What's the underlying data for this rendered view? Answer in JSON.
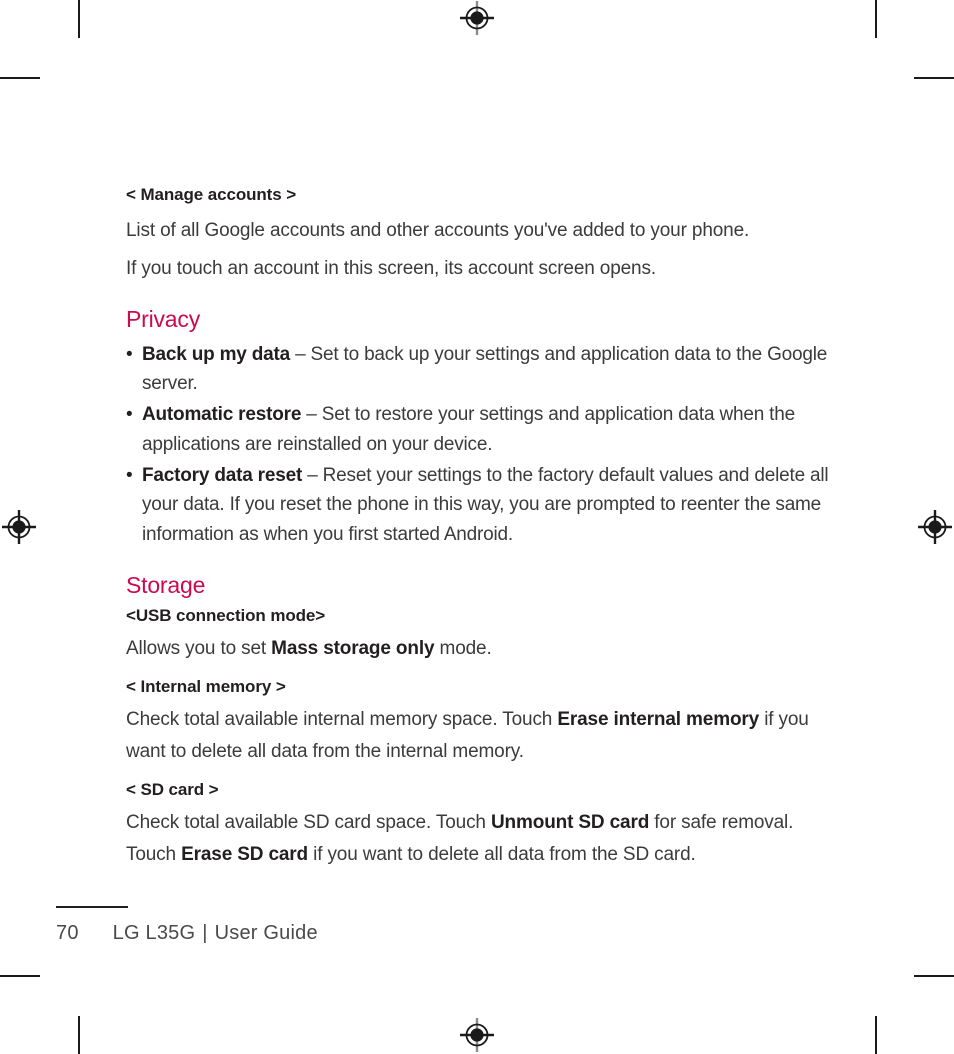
{
  "page": {
    "number": "70",
    "footer_title": "LG L35G",
    "footer_separator": "|",
    "footer_subtitle": "User Guide"
  },
  "theme": {
    "heading_color": "#CC0A4E",
    "body_color": "#3b3b3b",
    "bold_color": "#231f20"
  },
  "sections": {
    "manage_accounts": {
      "heading": "< Manage accounts >",
      "paragraph_1": "List of all Google accounts and other accounts you've added to your phone.",
      "paragraph_2": "If you touch an account in this screen, its account screen opens."
    },
    "privacy": {
      "heading": "Privacy",
      "bullet_char": "•",
      "items": [
        {
          "term": "Back up my data",
          "dash": "–",
          "description": "Set to back up your settings and application data to the Google server."
        },
        {
          "term": "Automatic restore",
          "dash": "–",
          "description": "Set to restore your settings and application data when the applications are reinstalled on your device."
        },
        {
          "term": "Factory data reset",
          "dash": "–",
          "description": "Reset your settings to the factory default values and delete all your data. If you reset the phone in this way, you are prompted to reenter the same information as when you first started Android."
        }
      ]
    },
    "storage": {
      "heading": "Storage",
      "usb": {
        "subheading": "<USB connection mode>",
        "text_before": "Allows you to set ",
        "bold_term": "Mass storage only",
        "text_after": " mode."
      },
      "internal_memory": {
        "subheading": "< Internal memory >",
        "text_before": "Check total available internal memory space. Touch ",
        "bold_term": "Erase internal memory",
        "text_after": " if you want to delete all data from the internal memory."
      },
      "sd_card": {
        "subheading": "< SD card >",
        "text_before": "Check total available SD card space. Touch ",
        "bold_term_1": "Unmount SD card",
        "text_middle": " for safe removal. Touch ",
        "bold_term_2": "Erase SD card",
        "text_after": " if you want to delete all data from the SD card."
      }
    }
  },
  "print_marks": {
    "registration_icon": "registration-target-icon",
    "crop_mark_icon": "crop-mark-icon"
  }
}
